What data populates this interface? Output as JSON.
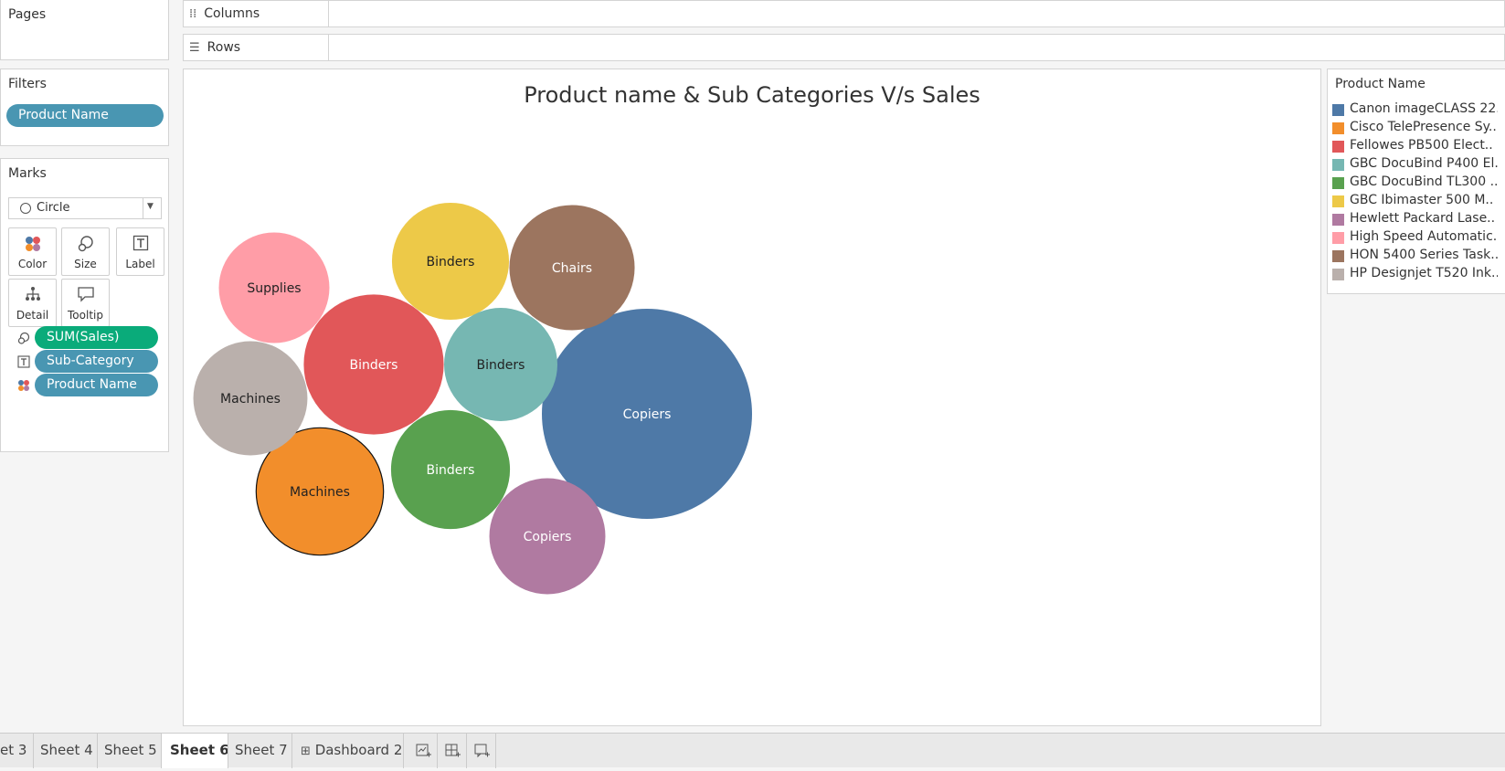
{
  "pages_panel": {
    "title": "Pages"
  },
  "shelves": {
    "columns": {
      "label": "Columns",
      "icon": "columns-icon"
    },
    "rows": {
      "label": "Rows",
      "icon": "rows-icon"
    }
  },
  "filters_panel": {
    "title": "Filters",
    "pills": [
      "Product Name"
    ]
  },
  "marks_panel": {
    "title": "Marks",
    "mark_type": "Circle",
    "buttons": [
      {
        "label": "Color",
        "icon": "color-icon"
      },
      {
        "label": "Size",
        "icon": "size-icon"
      },
      {
        "label": "Label",
        "icon": "label-icon"
      },
      {
        "label": "Detail",
        "icon": "detail-icon"
      },
      {
        "label": "Tooltip",
        "icon": "tooltip-icon"
      }
    ],
    "fields": [
      {
        "label": "SUM(Sales)",
        "icon": "size-icon",
        "color": "#0aab7a"
      },
      {
        "label": "Sub-Category",
        "icon": "label-icon",
        "color": "#4996b2"
      },
      {
        "label": "Product Name",
        "icon": "color-icon",
        "color": "#4996b2"
      }
    ]
  },
  "legend": {
    "title": "Product Name",
    "items": [
      {
        "label": "Canon imageCLASS 22..",
        "color": "#4e79a7"
      },
      {
        "label": "Cisco TelePresence Sy..",
        "color": "#f28e2b"
      },
      {
        "label": "Fellowes PB500 Elect..",
        "color": "#e15759"
      },
      {
        "label": "GBC DocuBind P400 El..",
        "color": "#76b7b2"
      },
      {
        "label": "GBC DocuBind TL300 ..",
        "color": "#59a14f"
      },
      {
        "label": "GBC Ibimaster 500 M..",
        "color": "#edc948"
      },
      {
        "label": "Hewlett Packard Lase..",
        "color": "#b07aa1"
      },
      {
        "label": "High Speed Automatic..",
        "color": "#ff9da7"
      },
      {
        "label": "HON 5400 Series Task..",
        "color": "#9c755f"
      },
      {
        "label": "HP Designjet T520 Ink..",
        "color": "#bab0ac"
      }
    ]
  },
  "tabs": [
    "et 3",
    "Sheet 4",
    "Sheet 5",
    "Sheet 6",
    "Sheet 7",
    "Dashboard 2"
  ],
  "active_tab": "Sheet 6",
  "tab_actions": [
    "new-worksheet-icon",
    "new-dashboard-icon",
    "new-story-icon"
  ],
  "chart_data": {
    "type": "packed-bubble",
    "title": "Product name & Sub Categories V/s Sales",
    "size_measure": "SUM(Sales)",
    "bubbles": [
      {
        "label": "Copiers",
        "product": "Canon imageCLASS 22..",
        "color": "#4e79a7",
        "relative_size": 1.0,
        "text_color": "#ffffff"
      },
      {
        "label": "Binders",
        "product": "Fellowes PB500 Elect..",
        "color": "#e15759",
        "relative_size": 0.666,
        "text_color": "#ffffff"
      },
      {
        "label": "Chairs",
        "product": "HON 5400 Series Task..",
        "color": "#9c755f",
        "relative_size": 0.596,
        "text_color": "#ffffff"
      },
      {
        "label": "Machines",
        "product": "Cisco TelePresence Sy..",
        "color": "#f28e2b",
        "relative_size": 0.606,
        "text_color": "#222222"
      },
      {
        "label": "Binders",
        "product": "GBC DocuBind TL300 ..",
        "color": "#59a14f",
        "relative_size": 0.566,
        "text_color": "#ffffff"
      },
      {
        "label": "Binders",
        "product": "GBC Ibimaster 500 M..",
        "color": "#edc948",
        "relative_size": 0.557,
        "text_color": "#222222"
      },
      {
        "label": "Copiers",
        "product": "Hewlett Packard Lase..",
        "color": "#b07aa1",
        "relative_size": 0.552,
        "text_color": "#ffffff"
      },
      {
        "label": "Binders",
        "product": "GBC DocuBind P400 El..",
        "color": "#76b7b2",
        "relative_size": 0.539,
        "text_color": "#222222"
      },
      {
        "label": "Machines",
        "product": "HP Designjet T520 Ink..",
        "color": "#bab0ac",
        "relative_size": 0.543,
        "text_color": "#222222"
      },
      {
        "label": "Supplies",
        "product": "High Speed Automatic..",
        "color": "#ff9da7",
        "relative_size": 0.526,
        "text_color": "#222222"
      }
    ]
  }
}
